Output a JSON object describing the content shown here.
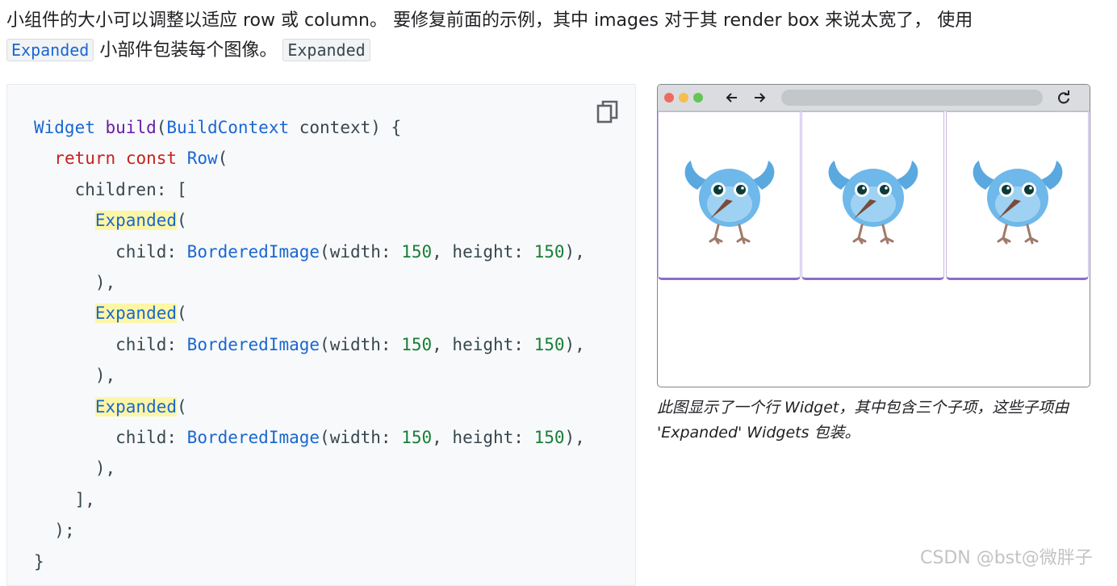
{
  "intro": {
    "text_before": "小组件的大小可以调整以适应 row 或 column。 要修复前面的示例，其中 images 对于其 render box 来说太宽了， 使用",
    "code_link": "Expanded",
    "text_middle": "小部件包装每个图像。",
    "code_plain": "Expanded"
  },
  "code": {
    "lines": {
      "l1": {
        "a": "Widget",
        "b": "build",
        "c": "(",
        "d": "BuildContext",
        "e": " context) {"
      },
      "l2": {
        "a": "return",
        "b": "const",
        "c": "Row",
        "d": "("
      },
      "l3": {
        "a": "children: ["
      },
      "exp_kw": "Expanded",
      "paren_open": "(",
      "child_label": "child: ",
      "bordered": "BorderedImage",
      "args_a": "(width: ",
      "num": "150",
      "args_b": ", height: ",
      "args_c": "),",
      "close_item": "),",
      "close_list": "],",
      "close_row": ");",
      "close_fn": "}"
    }
  },
  "copy_button": {
    "icon": "copy-icon"
  },
  "browser": {
    "tiles": 3,
    "bird_colors": {
      "body": "#6fb8ea",
      "wing": "#5aa8e0",
      "face": "#9fd2f2",
      "beak": "#7a4a3a",
      "feet": "#a07a6a",
      "eye": "#0b3a3a"
    }
  },
  "caption": "此图显示了一个行 Widget，其中包含三个子项，这些子项由 'Expanded' Widgets 包装。",
  "watermark": "CSDN @bst@微胖子"
}
